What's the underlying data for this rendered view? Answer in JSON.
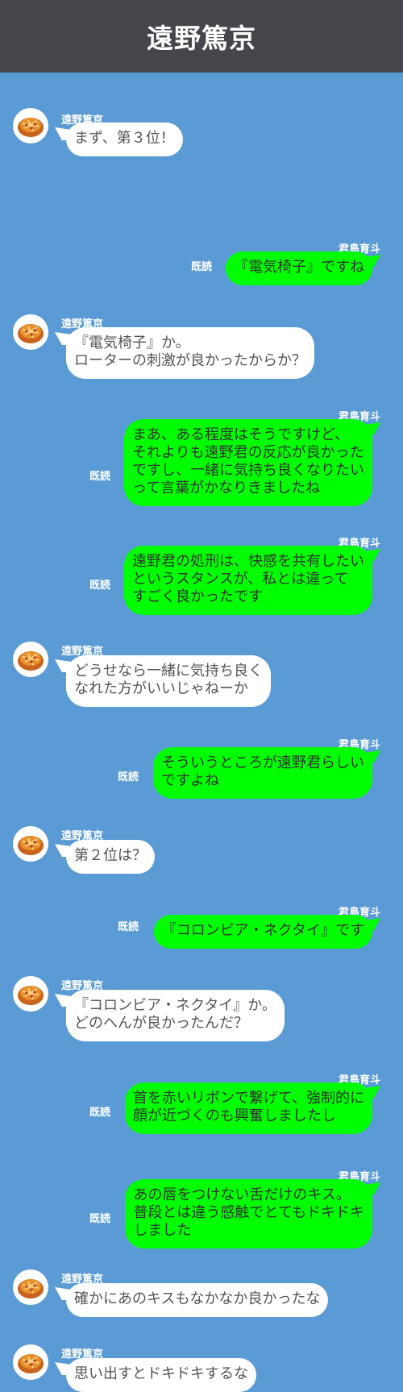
{
  "header": {
    "title": "遠野篤京"
  },
  "messages": [
    {
      "sender": "遠野篤京",
      "text": "まず、第３位！"
    },
    {
      "sender": "君島育斗",
      "text": "『電気椅子』ですね",
      "read": "既読"
    },
    {
      "sender": "遠野篤京",
      "text": "『電気椅子』か。\nローターの刺激が良かったからか？"
    },
    {
      "sender": "君島育斗",
      "text": "まあ、ある程度はそうですけど、\nそれよりも遠野君の反応が良かった\nですし、一緒に気持ち良くなりたい\nって言葉がかなりきましたね",
      "read": "既読"
    },
    {
      "sender": "君島育斗",
      "text": "遠野君の処刑は、快感を共有したい\nというスタンスが、私とは違って\nすごく良かったです",
      "read": "既読"
    },
    {
      "sender": "遠野篤京",
      "text": "どうせなら一緒に気持ち良く\nなれた方がいいじゃねーか"
    },
    {
      "sender": "君島育斗",
      "text": "そういうところが遠野君らしい\nですよね",
      "read": "既読"
    },
    {
      "sender": "遠野篤京",
      "text": "第２位は？"
    },
    {
      "sender": "君島育斗",
      "text": "『コロンビア・ネクタイ』です",
      "read": "既読"
    },
    {
      "sender": "遠野篤京",
      "text": "『コロンビア・ネクタイ』か。\nどのへんが良かったんだ？"
    },
    {
      "sender": "君島育斗",
      "text": "首を赤いリボンで繋げて、強制的に\n顔が近づくのも興奮しましたし",
      "read": "既読"
    },
    {
      "sender": "君島育斗",
      "text": "あの唇をつけない舌だけのキス。\n普段とは違う感触でとてもドキドキ\nしました",
      "read": "既読"
    },
    {
      "sender": "遠野篤京",
      "text": "確かにあのキスもなかなか良かったな"
    },
    {
      "sender": "遠野篤京",
      "text": "思い出すとドキドキするな"
    }
  ]
}
